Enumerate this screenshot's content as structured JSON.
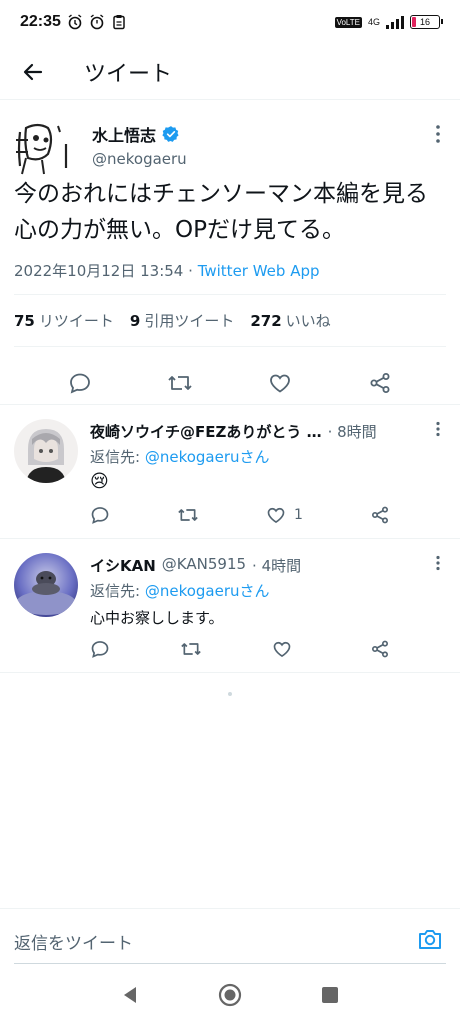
{
  "status_bar": {
    "time": "22:35",
    "volte": "VoLTE",
    "network": "4G",
    "battery": "16"
  },
  "header": {
    "title": "ツイート"
  },
  "tweet": {
    "author_name": "水上悟志",
    "author_handle": "@nekogaeru",
    "text": "今のおれにはチェンソーマン本編を見る心の力が無い。OPだけ見てる。",
    "datetime": "2022年10月12日 13:54",
    "separator": "·",
    "source": "Twitter Web App",
    "retweets_count": "75",
    "retweets_label": "リツイート",
    "quotes_count": "9",
    "quotes_label": "引用ツイート",
    "likes_count": "272",
    "likes_label": "いいね"
  },
  "replies": [
    {
      "name": "夜崎ソウイチ@FEZありがとう …",
      "handle": "",
      "time": "· 8時間",
      "reply_prefix": "返信先:",
      "reply_to": "@nekogaeruさん",
      "body": "😢",
      "like_count": "1"
    },
    {
      "name": "イシKAN",
      "handle": "@KAN5915",
      "time": "· 4時間",
      "reply_prefix": "返信先:",
      "reply_to": "@nekogaeruさん",
      "body": "心中お察しします。",
      "like_count": ""
    }
  ],
  "composer": {
    "placeholder": "返信をツイート"
  },
  "colors": {
    "accent": "#1d9bf0",
    "text": "#0f1419",
    "muted": "#536471",
    "divider": "#eff3f4"
  }
}
